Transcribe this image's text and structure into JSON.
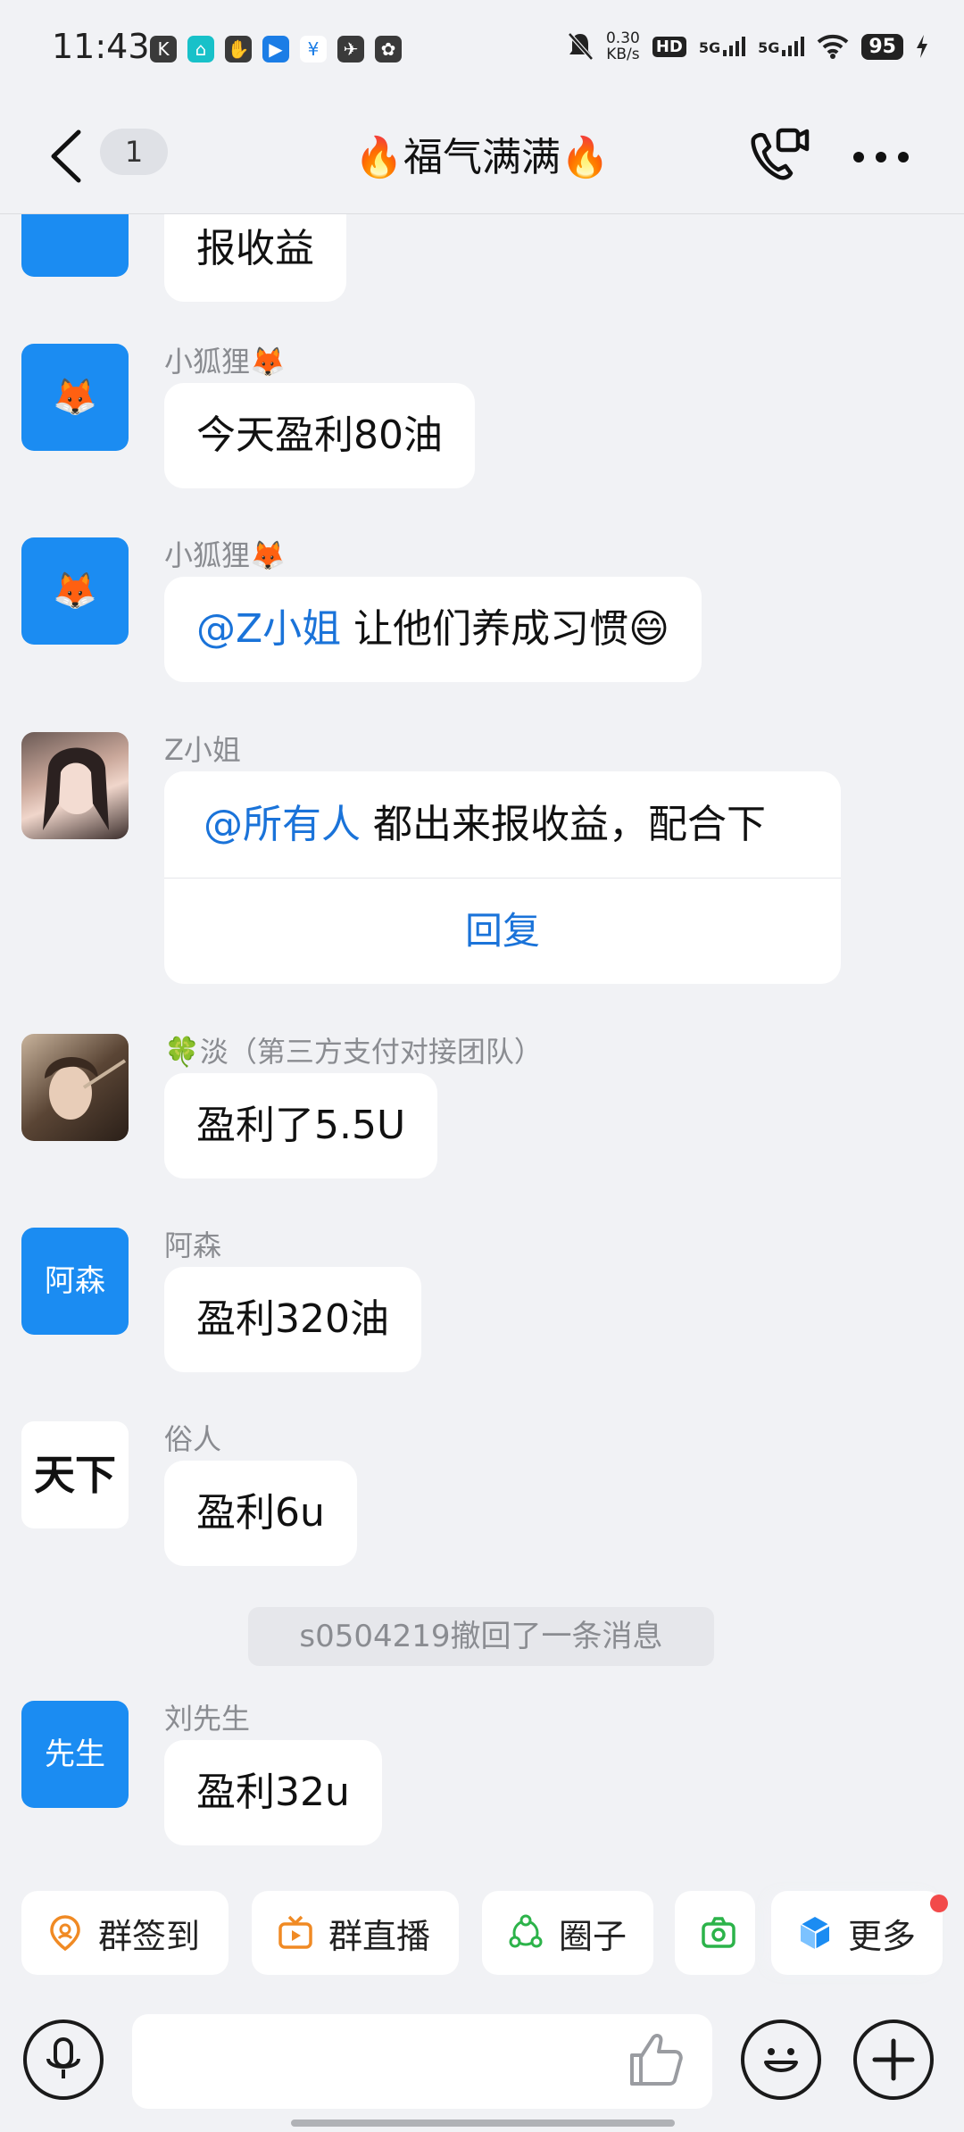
{
  "status_bar": {
    "time": "11:43",
    "app_icons": [
      "K",
      "⌂",
      "✋",
      "▶",
      "¥",
      "✈",
      "✿"
    ],
    "net_speed": "0.30",
    "net_unit": "KB/s",
    "signal1": "5G",
    "signal2": "5G",
    "hd": "HD",
    "battery": "95"
  },
  "header": {
    "unread_count": "1",
    "title": "🔥福气满满🔥"
  },
  "messages": [
    {
      "nick": "",
      "text": "报收益"
    },
    {
      "nick": "小狐狸🦊",
      "avatar_emoji": "🦊",
      "text": "今天盈利80油"
    },
    {
      "nick": "小狐狸🦊",
      "avatar_emoji": "🦊",
      "mention": "@Z小姐",
      "text": " 让他们养成习惯😄"
    },
    {
      "nick": "Z小姐",
      "mention": "@所有人",
      "text": " 都出来报收益，配合下",
      "reply_label": "回复"
    },
    {
      "nick": "🍀淡（第三方支付对接团队）",
      "text": "盈利了5.5U"
    },
    {
      "nick": "阿森",
      "avatar_text": "阿森",
      "text": "盈利320油"
    },
    {
      "nick": "俗人",
      "avatar_text": "天下",
      "text": "盈利6u"
    },
    {
      "nick": "刘先生",
      "avatar_text": "先生",
      "text": "盈利32u"
    }
  ],
  "system_notice": "s0504219撤回了一条消息",
  "quick_actions": [
    {
      "label": "群签到",
      "icon": "location-pin-icon",
      "color": "#f08a24"
    },
    {
      "label": "群直播",
      "icon": "tv-icon",
      "color": "#f08a24"
    },
    {
      "label": "圈子",
      "icon": "circle-nodes-icon",
      "color": "#2cb34a"
    },
    {
      "label": "",
      "icon": "camera-icon",
      "color": "#2cb34a"
    },
    {
      "label": "更多",
      "icon": "cube-icon",
      "color": "#1b8cf2"
    }
  ],
  "input": {
    "placeholder": ""
  },
  "colors": {
    "accent": "#1b8cf2",
    "mention": "#1a73d9",
    "background": "#f1f2f5"
  }
}
